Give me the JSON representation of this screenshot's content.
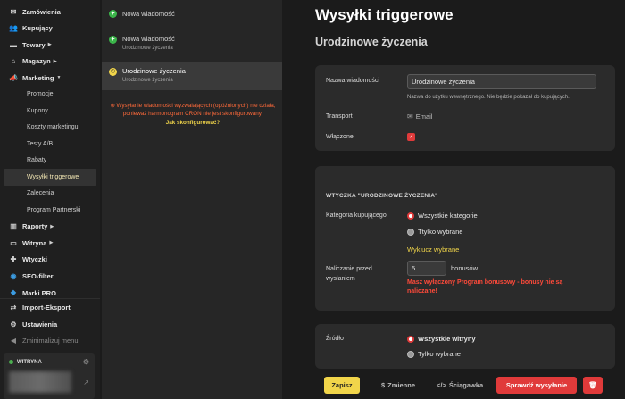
{
  "sidebar": {
    "items": [
      {
        "label": "Zamówienia",
        "icon": "envelope-icon"
      },
      {
        "label": "Kupujący",
        "icon": "users-icon"
      },
      {
        "label": "Towary",
        "icon": "box-icon"
      },
      {
        "label": "Magazyn",
        "icon": "warehouse-icon"
      },
      {
        "label": "Marketing",
        "icon": "megaphone-icon"
      }
    ],
    "marketing_sub": [
      "Promocje",
      "Kupony",
      "Koszty marketingu",
      "Testy A/B",
      "Rabaty",
      "Wysyłki triggerowe",
      "Zalecenia",
      "Program Partnerski"
    ],
    "items2": [
      {
        "label": "Raporty",
        "icon": "chart-icon"
      },
      {
        "label": "Witryna",
        "icon": "window-icon"
      },
      {
        "label": "Wtyczki",
        "icon": "puzzle-icon"
      },
      {
        "label": "SEO-filter",
        "icon": "globe-icon"
      },
      {
        "label": "Marki PRO",
        "icon": "tag-icon"
      },
      {
        "label": "Import-Eksport",
        "icon": "transfer-icon"
      },
      {
        "label": "Ustawienia",
        "icon": "gear-icon"
      }
    ],
    "minimize": "Zminimalizuj menu",
    "store_label": "WITRYNA"
  },
  "messages": {
    "new1": "Nowa wiadomość",
    "new2_title": "Nowa wiadomość",
    "new2_sub": "Urodzinowe życzenia",
    "sel_title": "Urodzinowe życzenia",
    "sel_sub": "Urodzinowe życzenia",
    "cron_warning": "Wysyłanie wiadomości wyzwalających (opóźnionych) nie działa, ponieważ harmonogram CRON nie jest skonfigurowany.",
    "cron_link": "Jak skonfigurować?"
  },
  "main": {
    "title": "Wysyłki triggerowe",
    "subtitle": "Urodzinowe życzenia",
    "name_label": "Nazwa wiadomości",
    "name_value": "Urodzinowe życzenia",
    "name_hint": "Nazwa do użytku wewnętrznego. Nie będzie pokazał do kupujących.",
    "transport_label": "Transport",
    "transport_value": "Email",
    "enabled_label": "Włączone",
    "plugin_heading": "WTYCZKA \"URODZINOWE ŻYCZENIA\"",
    "category_label": "Kategoria kupującego",
    "cat_all": "Wszystkie kategorie",
    "cat_selected": "Ttylko wybrane",
    "exclude_link": "Wyklucz wybrane",
    "bonus_label_1": "Naliczanie przed",
    "bonus_label_2": "wysłaniem",
    "bonus_value": "5",
    "bonus_unit": "bonusów",
    "bonus_warn_1": "Masz wyłączony Program bonusowy - bonusy nie są",
    "bonus_warn_2": "naliczane!",
    "source_label": "Źródło",
    "src_all": "Wszystkie witryny",
    "src_selected": "Tylko wybrane"
  },
  "toolbar": {
    "save": "Zapisz",
    "variables": "Zmienne",
    "cheatsheet": "Ściągawka",
    "check_send": "Sprawdź wysyłanie"
  },
  "colors": {
    "accent_yellow": "#f1d54a",
    "danger_red": "#e03a3a",
    "warn_orange": "#ff6a3a",
    "success_green": "#3bb54a"
  }
}
